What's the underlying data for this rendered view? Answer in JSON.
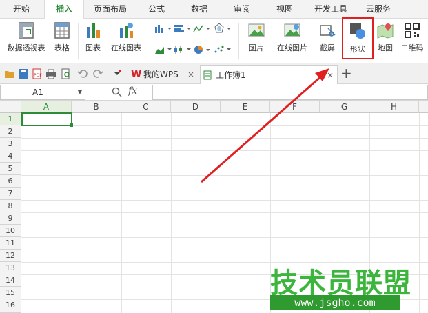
{
  "menu": {
    "tabs": [
      "开始",
      "插入",
      "页面布局",
      "公式",
      "数据",
      "审阅",
      "视图",
      "开发工具",
      "云服务"
    ],
    "active": "插入"
  },
  "ribbon": {
    "pivot_label": "数据透视表",
    "table_label": "表格",
    "chart_label": "图表",
    "online_chart_label": "在线图表",
    "picture_label": "图片",
    "online_picture_label": "在线图片",
    "screenshot_label": "截屏",
    "shape_label": "形状",
    "map_label": "地图",
    "qrcode_label": "二维码"
  },
  "doc_tabs": {
    "wps_label": "我的WPS",
    "workbook_label": "工作簿1"
  },
  "formula_bar": {
    "name_box": "A1",
    "fx_label": "fx",
    "value": ""
  },
  "sheet": {
    "columns": [
      "A",
      "B",
      "C",
      "D",
      "E",
      "F",
      "G",
      "H"
    ],
    "rows": [
      "1",
      "2",
      "3",
      "4",
      "5",
      "6",
      "7",
      "8",
      "9",
      "10",
      "11",
      "12",
      "13",
      "14",
      "15",
      "16"
    ],
    "active_cell": "A1"
  },
  "watermark": {
    "line1": "技术员联盟",
    "line2": "www.jsgho.com"
  },
  "colors": {
    "accent_green": "#2e8b3a",
    "highlight_red": "#e02020",
    "selection_green": "#2e8b3a"
  }
}
